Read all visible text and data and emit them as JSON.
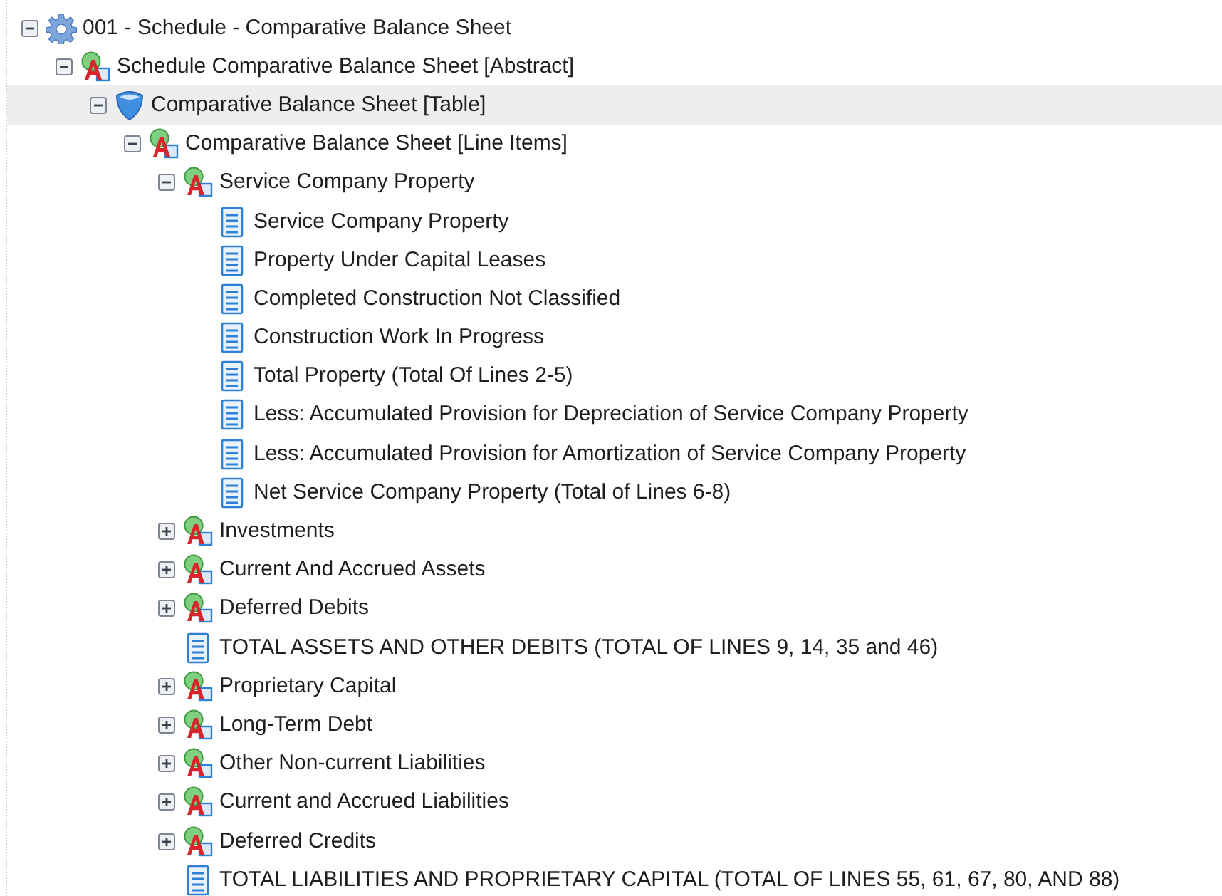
{
  "tree": [
    {
      "kind": "network",
      "label": "001 - Schedule - Comparative Balance Sheet",
      "expanded": true,
      "selected": false,
      "children": [
        {
          "kind": "abstract",
          "label": "Schedule Comparative Balance Sheet [Abstract]",
          "expanded": true,
          "selected": false,
          "children": [
            {
              "kind": "table",
              "label": "Comparative Balance Sheet [Table]",
              "expanded": true,
              "selected": true,
              "children": [
                {
                  "kind": "abstract",
                  "label": "Comparative Balance Sheet [Line Items]",
                  "expanded": true,
                  "selected": false,
                  "children": [
                    {
                      "kind": "abstract",
                      "label": "Service Company Property",
                      "expanded": true,
                      "selected": false,
                      "children": [
                        {
                          "kind": "item",
                          "label": "Service Company Property",
                          "selected": false
                        },
                        {
                          "kind": "item",
                          "label": "Property Under Capital Leases",
                          "selected": false
                        },
                        {
                          "kind": "item",
                          "label": "Completed Construction Not Classified",
                          "selected": false
                        },
                        {
                          "kind": "item",
                          "label": "Construction Work In Progress",
                          "selected": false
                        },
                        {
                          "kind": "item",
                          "label": "Total Property (Total Of Lines 2-5)",
                          "selected": false
                        },
                        {
                          "kind": "item",
                          "label": "Less: Accumulated Provision for Depreciation of Service Company Property",
                          "selected": false
                        },
                        {
                          "kind": "item",
                          "label": "Less: Accumulated Provision for Amortization of Service Company Property",
                          "selected": false
                        },
                        {
                          "kind": "item",
                          "label": "Net Service Company Property (Total of Lines 6-8)",
                          "selected": false
                        }
                      ]
                    },
                    {
                      "kind": "abstract",
                      "label": "Investments",
                      "expanded": false,
                      "selected": false
                    },
                    {
                      "kind": "abstract",
                      "label": "Current And Accrued Assets",
                      "expanded": false,
                      "selected": false
                    },
                    {
                      "kind": "abstract",
                      "label": "Deferred Debits",
                      "expanded": false,
                      "selected": false
                    },
                    {
                      "kind": "item",
                      "label": "TOTAL ASSETS AND OTHER DEBITS (TOTAL OF LINES 9, 14, 35 and 46)",
                      "selected": false
                    },
                    {
                      "kind": "abstract",
                      "label": "Proprietary Capital",
                      "expanded": false,
                      "selected": false
                    },
                    {
                      "kind": "abstract",
                      "label": "Long-Term Debt",
                      "expanded": false,
                      "selected": false
                    },
                    {
                      "kind": "abstract",
                      "label": "Other Non-current Liabilities",
                      "expanded": false,
                      "selected": false
                    },
                    {
                      "kind": "abstract",
                      "label": "Current and Accrued Liabilities",
                      "expanded": false,
                      "selected": false
                    },
                    {
                      "kind": "abstract",
                      "label": "Deferred Credits",
                      "expanded": false,
                      "selected": false
                    },
                    {
                      "kind": "item",
                      "label": "TOTAL LIABILITIES AND PROPRIETARY CAPITAL (TOTAL OF LINES 55, 61, 67, 80, AND 88)",
                      "selected": false
                    }
                  ]
                }
              ]
            }
          ]
        }
      ]
    }
  ]
}
